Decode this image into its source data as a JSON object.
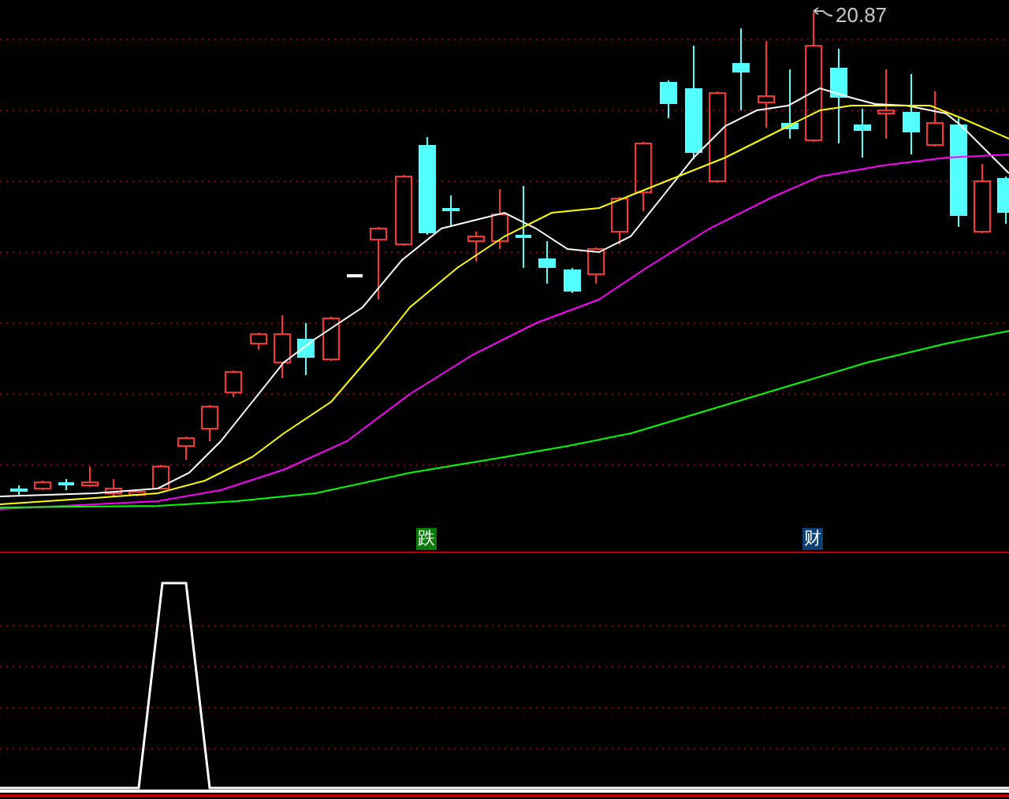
{
  "price_chart": {
    "high_label": "20.87",
    "signals": [
      {
        "label": "跌",
        "color": "#0b7a0b"
      },
      {
        "label": "财",
        "color": "#0c3f74"
      }
    ]
  }
}
